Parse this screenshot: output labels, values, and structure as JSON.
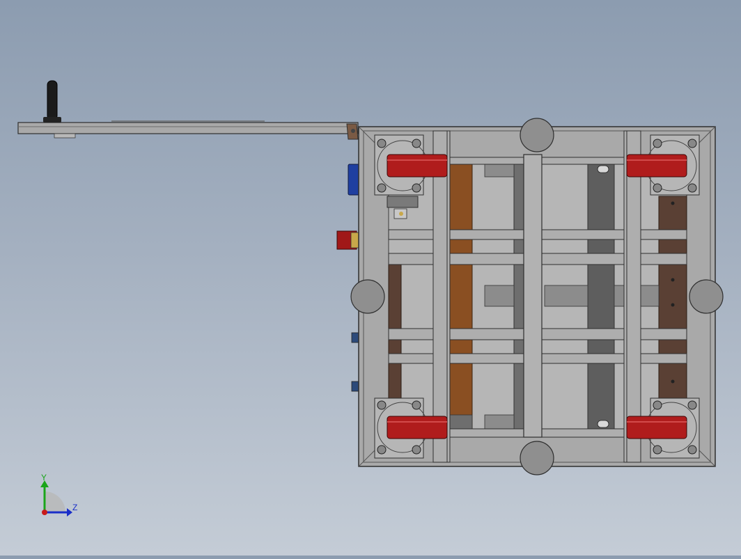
{
  "viewport": {
    "background_top": "#8c9cb0",
    "background_bottom": "#c4ccd6"
  },
  "model": {
    "frame_color": "#a7a7a7",
    "edge_color": "#2e2e2e",
    "wheel_color": "#b01c1c",
    "wood_color": "#8a4f22",
    "dark_wood_color": "#5a4034",
    "blue_box_color": "#1f3fa0",
    "red_box_color": "#a01818"
  },
  "triad": {
    "y_label": "Y",
    "z_label": "Z",
    "y_color": "#1aa51a",
    "z_color": "#1a2ec8",
    "x_color": "#c81a1a"
  }
}
